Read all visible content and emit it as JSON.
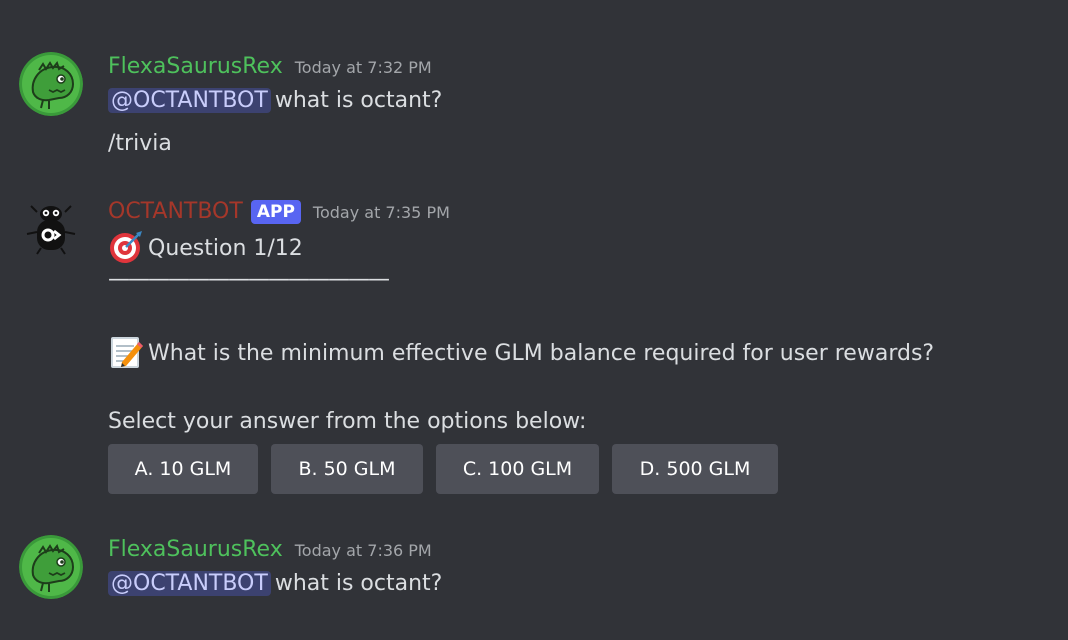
{
  "colors": {
    "background": "#313338",
    "user_name": "#4ec15c",
    "bot_name": "#a5372a",
    "app_badge": "#5865f2",
    "mention_bg": "#3c4270",
    "button_bg": "#4e5058"
  },
  "messages": [
    {
      "author": "FlexaSaurusRex",
      "timestamp": "Today at 7:32 PM",
      "mention": "@OCTANTBOT",
      "text": "what is octant?",
      "line2": "/trivia",
      "avatar_icon": "green-dinosaur-avatar"
    },
    {
      "author": "OCTANTBOT",
      "badge": "APP",
      "timestamp": "Today at 7:35 PM",
      "avatar_icon": "octant-bot-avatar",
      "question_icon": "direct-hit-icon",
      "question_label": "Question 1/12",
      "divider": "——————————————",
      "prompt_icon": "memo-icon",
      "prompt": "What is the minimum effective GLM balance required for user rewards?",
      "instruction": "Select your answer from the options below:",
      "options": [
        "A. 10 GLM",
        "B. 50 GLM",
        "C. 100 GLM",
        "D. 500 GLM"
      ]
    },
    {
      "author": "FlexaSaurusRex",
      "timestamp": "Today at 7:36 PM",
      "mention": "@OCTANTBOT",
      "text": "what is octant?",
      "avatar_icon": "green-dinosaur-avatar"
    }
  ]
}
